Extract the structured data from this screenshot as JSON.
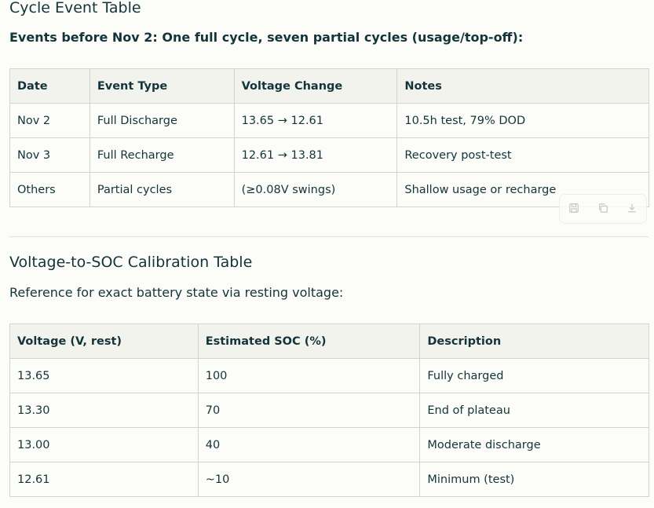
{
  "section1": {
    "title": "Cycle Event Table",
    "subtitle": "Events before Nov 2: One full cycle, seven partial cycles (usage/top-off):",
    "headers": [
      "Date",
      "Event Type",
      "Voltage Change",
      "Notes"
    ],
    "rows": [
      [
        "Nov 2",
        "Full Discharge",
        "13.65 → 12.61",
        "10.5h test, 79% DOD"
      ],
      [
        "Nov 3",
        "Full Recharge",
        "12.61 → 13.81",
        "Recovery post-test"
      ],
      [
        "Others",
        "Partial cycles",
        "(≥0.08V swings)",
        "Shallow usage or recharge"
      ]
    ]
  },
  "section2": {
    "title": "Voltage-to-SOC Calibration Table",
    "paragraph": "Reference for exact battery state via resting voltage:",
    "headers": [
      "Voltage (V, rest)",
      "Estimated SOC (%)",
      "Description"
    ],
    "rows": [
      [
        "13.65",
        "100",
        "Fully charged"
      ],
      [
        "13.30",
        "70",
        "End of plateau"
      ],
      [
        "13.00",
        "40",
        "Moderate discharge"
      ],
      [
        "12.61",
        "~10",
        "Minimum (test)"
      ]
    ]
  },
  "toolbar": {
    "icons": [
      "save-icon",
      "copy-icon",
      "download-icon"
    ]
  }
}
